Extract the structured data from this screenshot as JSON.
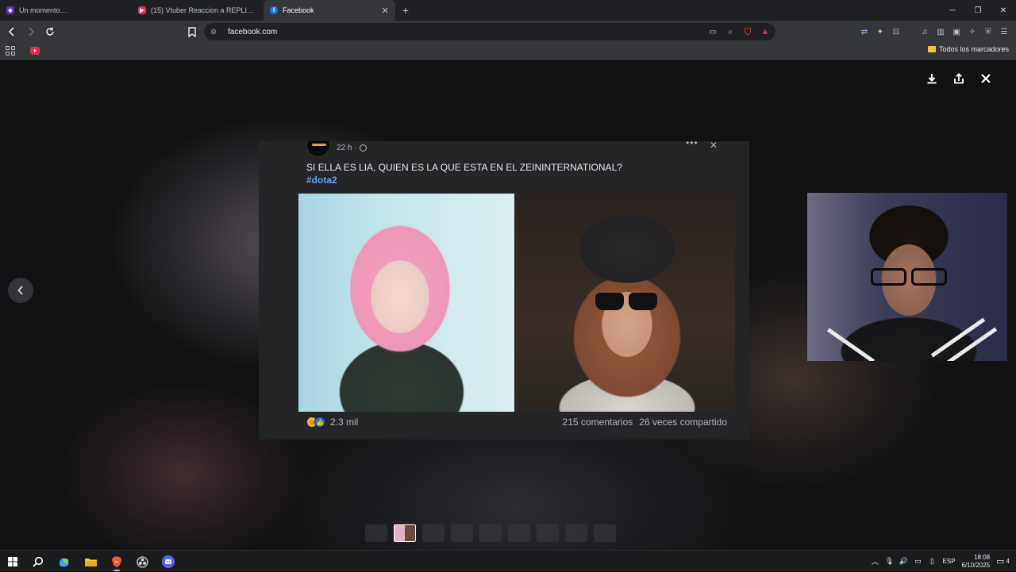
{
  "browser": {
    "tabs": [
      {
        "label": "Un momento…",
        "favicon": "brave-icon",
        "active": false
      },
      {
        "label": "(15) Vtuber Reaccion a REPLIK por pr",
        "favicon": "youtube-icon",
        "active": false
      },
      {
        "label": "Facebook",
        "favicon": "facebook-icon",
        "active": true
      }
    ],
    "url": "facebook.com",
    "bookmarks_folder": "Todos los marcadores"
  },
  "post": {
    "time": "22 h ·",
    "text": "SI ELLA ES LIA, QUIEN ES LA QUE ESTA EN EL ZEININTERNATIONAL?",
    "hashtag": "#dota2",
    "reactions_count": "2.3 mil",
    "comments": "215 comentarios",
    "shares": "26 veces compartido"
  },
  "taskbar": {
    "language": "ESP",
    "time": "18:08",
    "date": "6/10/2025",
    "notifications": "4"
  },
  "colors": {
    "facebook_blue": "#1877f2",
    "hashtag": "#5aa7ff",
    "card_bg": "#242526"
  }
}
